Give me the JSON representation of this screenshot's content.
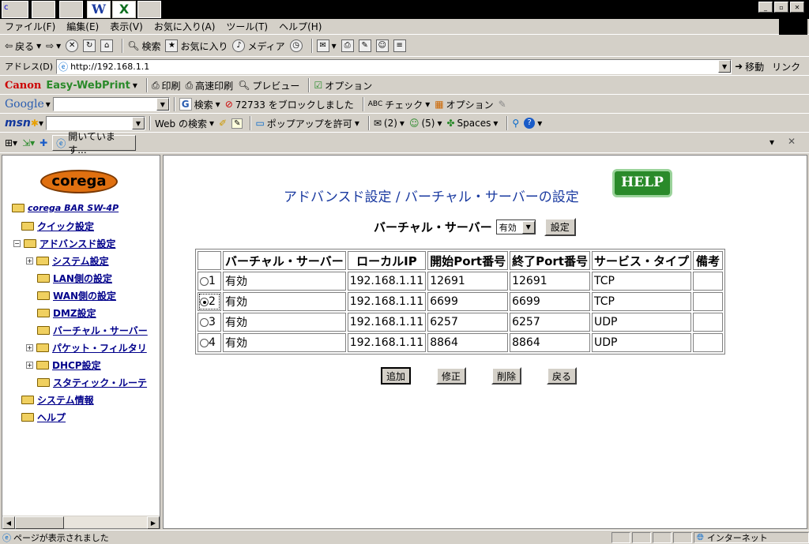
{
  "taskbar": {
    "items": [
      "c",
      "W",
      "X"
    ]
  },
  "menu": {
    "items": [
      "ファイル(F)",
      "編集(E)",
      "表示(V)",
      "お気に入り(A)",
      "ツール(T)",
      "ヘルプ(H)"
    ]
  },
  "toolbar": {
    "back": "戻る",
    "search": "検索",
    "favorites": "お気に入り",
    "media": "メディア"
  },
  "address": {
    "label": "アドレス(D)",
    "url": "http://192.168.1.1",
    "go": "移動",
    "links": "リンク"
  },
  "canon": {
    "brand": "Canon",
    "product": "Easy-WebPrint",
    "print": "印刷",
    "fast_print": "高速印刷",
    "preview": "プレビュー",
    "option": "オプション"
  },
  "google": {
    "brand": "Google",
    "search": "検索",
    "blocked": "72733 をブロックしました",
    "check": "チェック",
    "option": "オプション"
  },
  "msn": {
    "brand": "msn",
    "web_search": "Web の検索",
    "popup": "ポップアップを許可",
    "mail": "(2)",
    "people": "(5)",
    "spaces": "Spaces"
  },
  "tabbar": {
    "tab": "開いています..."
  },
  "sidebar": {
    "logo": "corega",
    "root": "corega BAR SW-4P",
    "items": [
      "クイック設定",
      "アドバンスド設定",
      "システム設定",
      "LAN側の設定",
      "WAN側の設定",
      "DMZ設定",
      "バーチャル・サーバー",
      "パケット・フィルタリ",
      "DHCP設定",
      "スタティック・ルーテ",
      "システム情報",
      "ヘルプ"
    ]
  },
  "main": {
    "title": "アドバンスド設定 / バーチャル・サーバーの設定",
    "help": "HELP",
    "vs_label": "バーチャル・サーバー",
    "vs_select": "有効",
    "set_button": "設定",
    "headers": [
      "バーチャル・サーバー",
      "ローカルIP",
      "開始Port番号",
      "終了Port番号",
      "サービス・タイプ",
      "備考"
    ],
    "rows": [
      {
        "no": "1",
        "status": "有効",
        "ip": "192.168.1.11",
        "start": "12691",
        "end": "12691",
        "type": "TCP",
        "note": "",
        "selected": false
      },
      {
        "no": "2",
        "status": "有効",
        "ip": "192.168.1.11",
        "start": "6699",
        "end": "6699",
        "type": "TCP",
        "note": "",
        "selected": true
      },
      {
        "no": "3",
        "status": "有効",
        "ip": "192.168.1.11",
        "start": "6257",
        "end": "6257",
        "type": "UDP",
        "note": "",
        "selected": false
      },
      {
        "no": "4",
        "status": "有効",
        "ip": "192.168.1.11",
        "start": "8864",
        "end": "8864",
        "type": "UDP",
        "note": "",
        "selected": false
      }
    ],
    "actions": [
      "追加",
      "修正",
      "削除",
      "戻る"
    ]
  },
  "status": {
    "text": "ページが表示されました",
    "zone": "インターネット"
  }
}
